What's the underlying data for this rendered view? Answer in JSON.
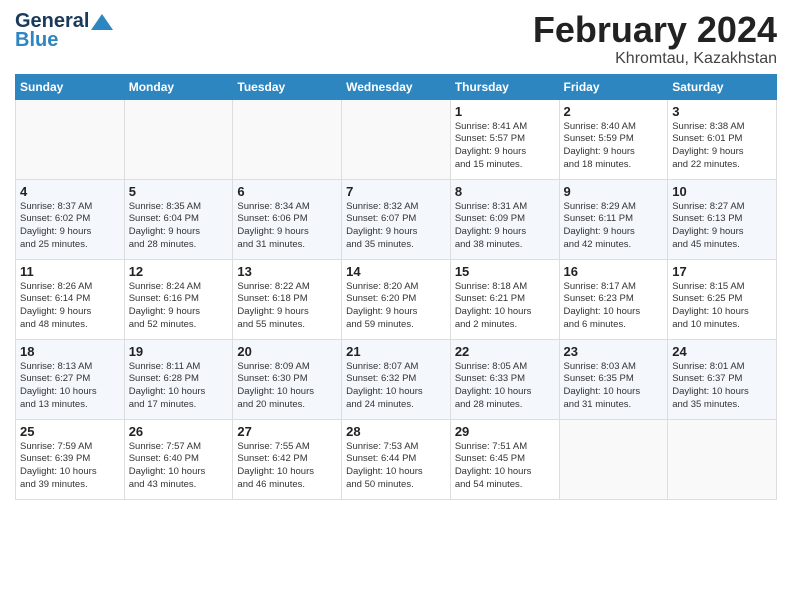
{
  "header": {
    "logo_line1": "General",
    "logo_line2": "Blue",
    "title": "February 2024",
    "subtitle": "Khromtau, Kazakhstan"
  },
  "weekdays": [
    "Sunday",
    "Monday",
    "Tuesday",
    "Wednesday",
    "Thursday",
    "Friday",
    "Saturday"
  ],
  "weeks": [
    [
      {
        "day": "",
        "info": ""
      },
      {
        "day": "",
        "info": ""
      },
      {
        "day": "",
        "info": ""
      },
      {
        "day": "",
        "info": ""
      },
      {
        "day": "1",
        "info": "Sunrise: 8:41 AM\nSunset: 5:57 PM\nDaylight: 9 hours\nand 15 minutes."
      },
      {
        "day": "2",
        "info": "Sunrise: 8:40 AM\nSunset: 5:59 PM\nDaylight: 9 hours\nand 18 minutes."
      },
      {
        "day": "3",
        "info": "Sunrise: 8:38 AM\nSunset: 6:01 PM\nDaylight: 9 hours\nand 22 minutes."
      }
    ],
    [
      {
        "day": "4",
        "info": "Sunrise: 8:37 AM\nSunset: 6:02 PM\nDaylight: 9 hours\nand 25 minutes."
      },
      {
        "day": "5",
        "info": "Sunrise: 8:35 AM\nSunset: 6:04 PM\nDaylight: 9 hours\nand 28 minutes."
      },
      {
        "day": "6",
        "info": "Sunrise: 8:34 AM\nSunset: 6:06 PM\nDaylight: 9 hours\nand 31 minutes."
      },
      {
        "day": "7",
        "info": "Sunrise: 8:32 AM\nSunset: 6:07 PM\nDaylight: 9 hours\nand 35 minutes."
      },
      {
        "day": "8",
        "info": "Sunrise: 8:31 AM\nSunset: 6:09 PM\nDaylight: 9 hours\nand 38 minutes."
      },
      {
        "day": "9",
        "info": "Sunrise: 8:29 AM\nSunset: 6:11 PM\nDaylight: 9 hours\nand 42 minutes."
      },
      {
        "day": "10",
        "info": "Sunrise: 8:27 AM\nSunset: 6:13 PM\nDaylight: 9 hours\nand 45 minutes."
      }
    ],
    [
      {
        "day": "11",
        "info": "Sunrise: 8:26 AM\nSunset: 6:14 PM\nDaylight: 9 hours\nand 48 minutes."
      },
      {
        "day": "12",
        "info": "Sunrise: 8:24 AM\nSunset: 6:16 PM\nDaylight: 9 hours\nand 52 minutes."
      },
      {
        "day": "13",
        "info": "Sunrise: 8:22 AM\nSunset: 6:18 PM\nDaylight: 9 hours\nand 55 minutes."
      },
      {
        "day": "14",
        "info": "Sunrise: 8:20 AM\nSunset: 6:20 PM\nDaylight: 9 hours\nand 59 minutes."
      },
      {
        "day": "15",
        "info": "Sunrise: 8:18 AM\nSunset: 6:21 PM\nDaylight: 10 hours\nand 2 minutes."
      },
      {
        "day": "16",
        "info": "Sunrise: 8:17 AM\nSunset: 6:23 PM\nDaylight: 10 hours\nand 6 minutes."
      },
      {
        "day": "17",
        "info": "Sunrise: 8:15 AM\nSunset: 6:25 PM\nDaylight: 10 hours\nand 10 minutes."
      }
    ],
    [
      {
        "day": "18",
        "info": "Sunrise: 8:13 AM\nSunset: 6:27 PM\nDaylight: 10 hours\nand 13 minutes."
      },
      {
        "day": "19",
        "info": "Sunrise: 8:11 AM\nSunset: 6:28 PM\nDaylight: 10 hours\nand 17 minutes."
      },
      {
        "day": "20",
        "info": "Sunrise: 8:09 AM\nSunset: 6:30 PM\nDaylight: 10 hours\nand 20 minutes."
      },
      {
        "day": "21",
        "info": "Sunrise: 8:07 AM\nSunset: 6:32 PM\nDaylight: 10 hours\nand 24 minutes."
      },
      {
        "day": "22",
        "info": "Sunrise: 8:05 AM\nSunset: 6:33 PM\nDaylight: 10 hours\nand 28 minutes."
      },
      {
        "day": "23",
        "info": "Sunrise: 8:03 AM\nSunset: 6:35 PM\nDaylight: 10 hours\nand 31 minutes."
      },
      {
        "day": "24",
        "info": "Sunrise: 8:01 AM\nSunset: 6:37 PM\nDaylight: 10 hours\nand 35 minutes."
      }
    ],
    [
      {
        "day": "25",
        "info": "Sunrise: 7:59 AM\nSunset: 6:39 PM\nDaylight: 10 hours\nand 39 minutes."
      },
      {
        "day": "26",
        "info": "Sunrise: 7:57 AM\nSunset: 6:40 PM\nDaylight: 10 hours\nand 43 minutes."
      },
      {
        "day": "27",
        "info": "Sunrise: 7:55 AM\nSunset: 6:42 PM\nDaylight: 10 hours\nand 46 minutes."
      },
      {
        "day": "28",
        "info": "Sunrise: 7:53 AM\nSunset: 6:44 PM\nDaylight: 10 hours\nand 50 minutes."
      },
      {
        "day": "29",
        "info": "Sunrise: 7:51 AM\nSunset: 6:45 PM\nDaylight: 10 hours\nand 54 minutes."
      },
      {
        "day": "",
        "info": ""
      },
      {
        "day": "",
        "info": ""
      }
    ]
  ]
}
